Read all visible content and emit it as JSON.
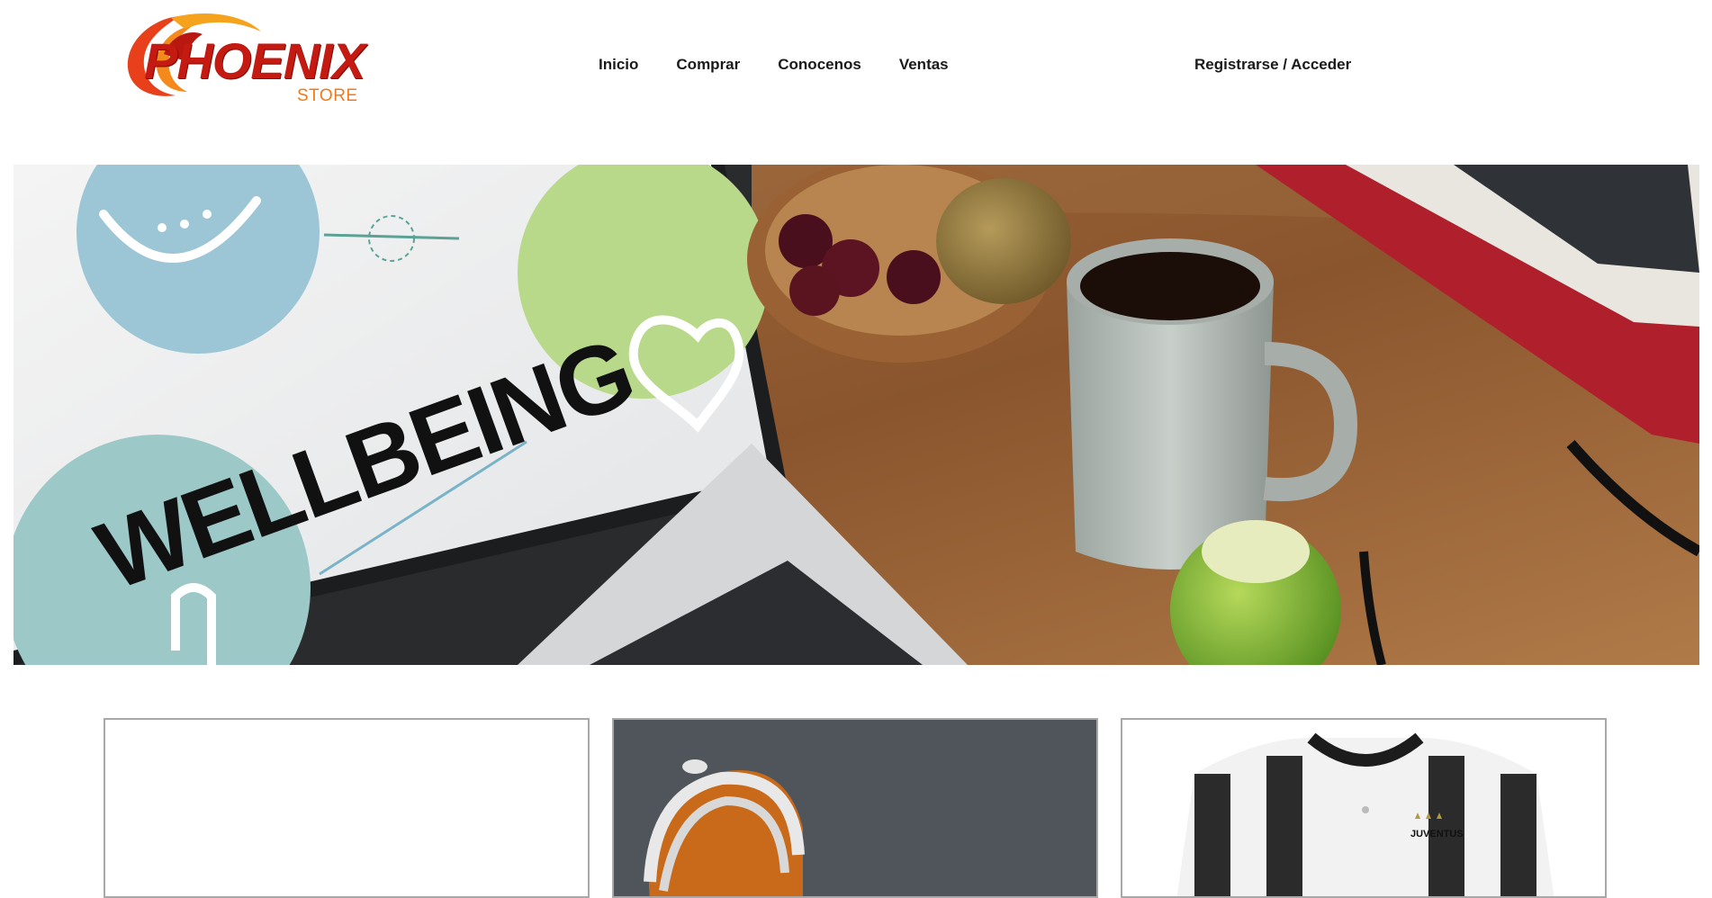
{
  "header": {
    "logo_main": "PHOENIX",
    "logo_sub": "STORE",
    "nav": [
      {
        "label": "Inicio"
      },
      {
        "label": "Comprar"
      },
      {
        "label": "Conocenos"
      },
      {
        "label": "Ventas"
      }
    ],
    "auth_label": "Registrarse / Acceder"
  },
  "hero": {
    "screen_text": "WELLBEING",
    "icons": [
      "watermelon-icon",
      "heart-icon",
      "popsicle-icon"
    ]
  },
  "cards": [
    {
      "image": "blank-product-image"
    },
    {
      "image": "headphones-product-image"
    },
    {
      "image": "juventus-jersey-product-image",
      "jersey_text": "JUVENTUS"
    }
  ],
  "colors": {
    "brand_red": "#c41a12",
    "brand_orange": "#f07a1a",
    "text_dark": "#1a1a1a",
    "card_border": "#a8a8a8"
  }
}
